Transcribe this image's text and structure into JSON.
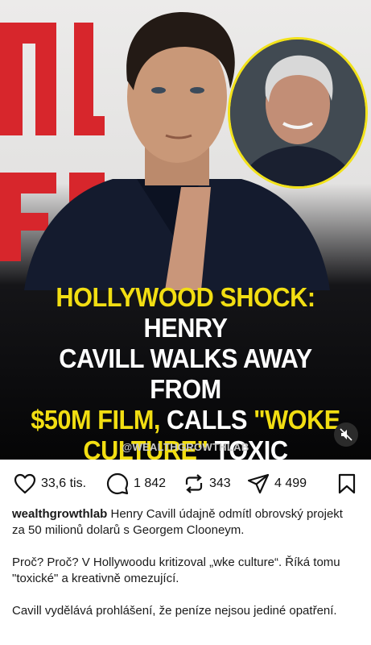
{
  "post": {
    "headline": {
      "line1_yellow": "HOLLYWOOD SHOCK:",
      "line1_white": " HENRY",
      "line2": "CAVILL WALKS AWAY FROM",
      "line3_yellow": "$50M FILM,",
      "line3_white": " CALLS ",
      "line3_yellow2": "\"WOKE",
      "line4_yellow": "CULTURE\"",
      "line4_white": " TOXIC"
    },
    "watermark": "@WEALTHGROWTHLAB",
    "mute_icon": "speaker-muted-icon"
  },
  "actions": {
    "likes": "33,6 tis.",
    "comments": "1 842",
    "reposts": "343",
    "shares": "4 499",
    "icons": [
      "heart-icon",
      "comment-icon",
      "repost-icon",
      "share-icon",
      "bookmark-icon"
    ]
  },
  "caption": {
    "username": "wealthgrowthlab",
    "text1": " Henry Cavill údajně odmítl obrovský projekt za 50 milionů dolarů s Georgem Clooneym.",
    "text2": "Proč? Proč? V Hollywoodu kritizoval „wke culture“. Říká tomu \"toxické\" a kreativně omezující.",
    "text3": "Cavill vydělává prohlášení, že peníze nejsou jediné opatření."
  },
  "colors": {
    "headline_yellow": "#f2de12",
    "inset_border": "#f2e21a",
    "poster_red": "#d7262c"
  }
}
